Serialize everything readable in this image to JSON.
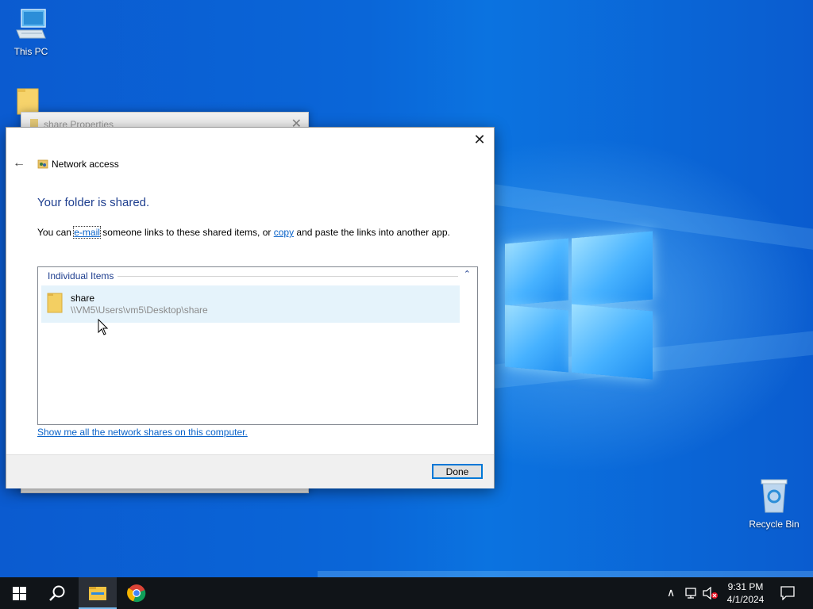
{
  "desktop": {
    "icons": [
      {
        "label": "This PC"
      },
      {
        "label": "Recycle Bin"
      }
    ]
  },
  "props_window": {
    "title": "share Properties",
    "close_glyph": "✕"
  },
  "dialog": {
    "close_glyph": "✕",
    "back_glyph": "←",
    "nav_title": "Network access",
    "headline": "Your folder is shared.",
    "desc_prefix": "You can ",
    "desc_link1": "e-mail",
    "desc_mid": " someone links to these shared items, or ",
    "desc_link2": "copy",
    "desc_suffix": " and paste the links into another app.",
    "group_header": "Individual Items",
    "group_collapse_glyph": "⌃",
    "item": {
      "name": "share",
      "path": "\\\\VM5\\Users\\vm5\\Desktop\\share"
    },
    "show_shares_link": "Show me all the network shares on this computer.",
    "done_label": "Done"
  },
  "taskbar": {
    "time": "9:31 PM",
    "date": "4/1/2024",
    "tray_chevron": "∧"
  },
  "colors": {
    "accent": "#0078d7",
    "link": "#0a63c9",
    "heading": "#1f3f8f",
    "taskbar": "#101418"
  },
  "icons": [
    "this-pc-icon",
    "folder-icon",
    "recycle-bin-icon",
    "windows-start-icon",
    "search-icon",
    "file-explorer-icon",
    "chrome-icon",
    "network-icon",
    "volume-muted-icon",
    "notification-icon"
  ]
}
